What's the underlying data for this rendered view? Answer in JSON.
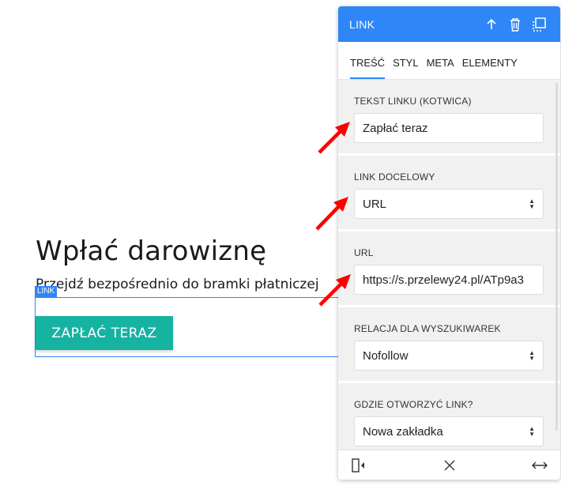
{
  "page": {
    "heading": "Wpłać darowiznę",
    "subtext": "Przejdź bezpośrednio do bramki płatniczej",
    "link_tag": "LINK",
    "pay_button_label": "ZAPŁAĆ TERAZ"
  },
  "panel": {
    "title": "LINK",
    "header_icons": [
      "arrow-up-icon",
      "trash-icon",
      "duplicate-icon"
    ],
    "tabs": [
      {
        "label": "TREŚĆ",
        "active": true
      },
      {
        "label": "STYL",
        "active": false
      },
      {
        "label": "META",
        "active": false
      },
      {
        "label": "ELEMENTY",
        "active": false
      }
    ],
    "fields": [
      {
        "label": "TEKST LINKU (KOTWICA)",
        "value": "Zapłać teraz",
        "type": "text"
      },
      {
        "label": "LINK DOCELOWY",
        "value": "URL",
        "type": "select"
      },
      {
        "label": "URL",
        "value": "https://s.przelewy24.pl/ATp9a3",
        "type": "text"
      },
      {
        "label": "RELACJA DLA WYSZUKIWAREK",
        "value": "Nofollow",
        "type": "select"
      },
      {
        "label": "GDZIE OTWORZYĆ LINK?",
        "value": "Nowa zakładka",
        "type": "select"
      }
    ],
    "footer_icons": [
      "panel-collapse-icon",
      "close-icon",
      "expand-horizontal-icon"
    ]
  },
  "colors": {
    "accent": "#2f86f6",
    "button": "#16b3a3",
    "annotation_arrow": "#ff0000"
  }
}
